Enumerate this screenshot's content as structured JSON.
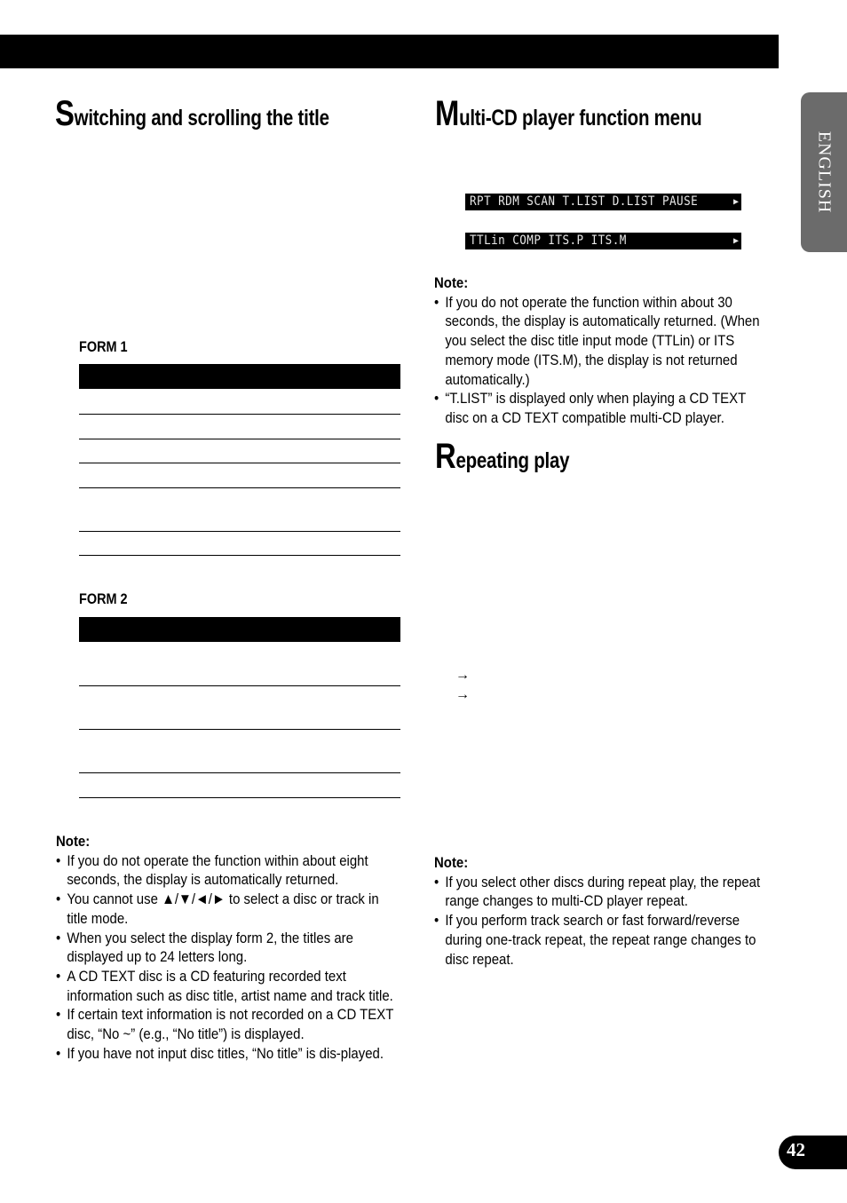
{
  "header": {
    "bar": ""
  },
  "language_tab": {
    "label": "ENGLISH"
  },
  "page_number": "42",
  "left_column": {
    "heading": {
      "initial": "S",
      "rest": "witching and scrolling the title"
    },
    "form1": {
      "label": "FORM 1",
      "rows": 6
    },
    "form2": {
      "label": "FORM 2",
      "rows": 4
    },
    "note": {
      "title": "Note:",
      "items": [
        "If you do not operate the function within about eight seconds, the display is automatically returned.",
        "You cannot use ▲/▼/◄/► to select a disc or track in title mode.",
        "When you select the display form 2, the titles are displayed up to 24 letters long.",
        "A CD TEXT disc is a CD featuring recorded text information such as disc title, artist name and track title.",
        "If certain text information is not recorded on a CD TEXT disc, “No ~” (e.g., “No title”) is displayed.",
        "If you have not input disc titles, “No title” is dis-played."
      ]
    }
  },
  "right_column": {
    "multi_cd": {
      "heading": {
        "initial": "M",
        "rest": "ulti-CD player function menu"
      },
      "display_1": {
        "text": "RPT  RDM  SCAN T.LIST D.LIST PAUSE",
        "arrow": "▶"
      },
      "display_2": {
        "text": "TTLin COMP ITS.P ITS.M",
        "arrow": "▶"
      },
      "note": {
        "title": "Note:",
        "items": [
          "If you do not operate the function within about 30 seconds, the display is automatically returned. (When you select the disc title input mode (TTLin) or ITS memory mode (ITS.M), the display is not returned automatically.)",
          "“T.LIST” is displayed only when playing a CD TEXT disc on a CD TEXT compatible multi-CD player."
        ]
      }
    },
    "repeat": {
      "heading": {
        "initial": "R",
        "rest": "epeating play"
      },
      "arrows": [
        "→",
        "→"
      ],
      "note": {
        "title": "Note:",
        "items": [
          "If you select other discs during repeat play, the repeat range changes to multi-CD player repeat.",
          "If you perform track search or fast forward/reverse during one-track repeat, the repeat range changes to disc repeat."
        ]
      }
    }
  }
}
